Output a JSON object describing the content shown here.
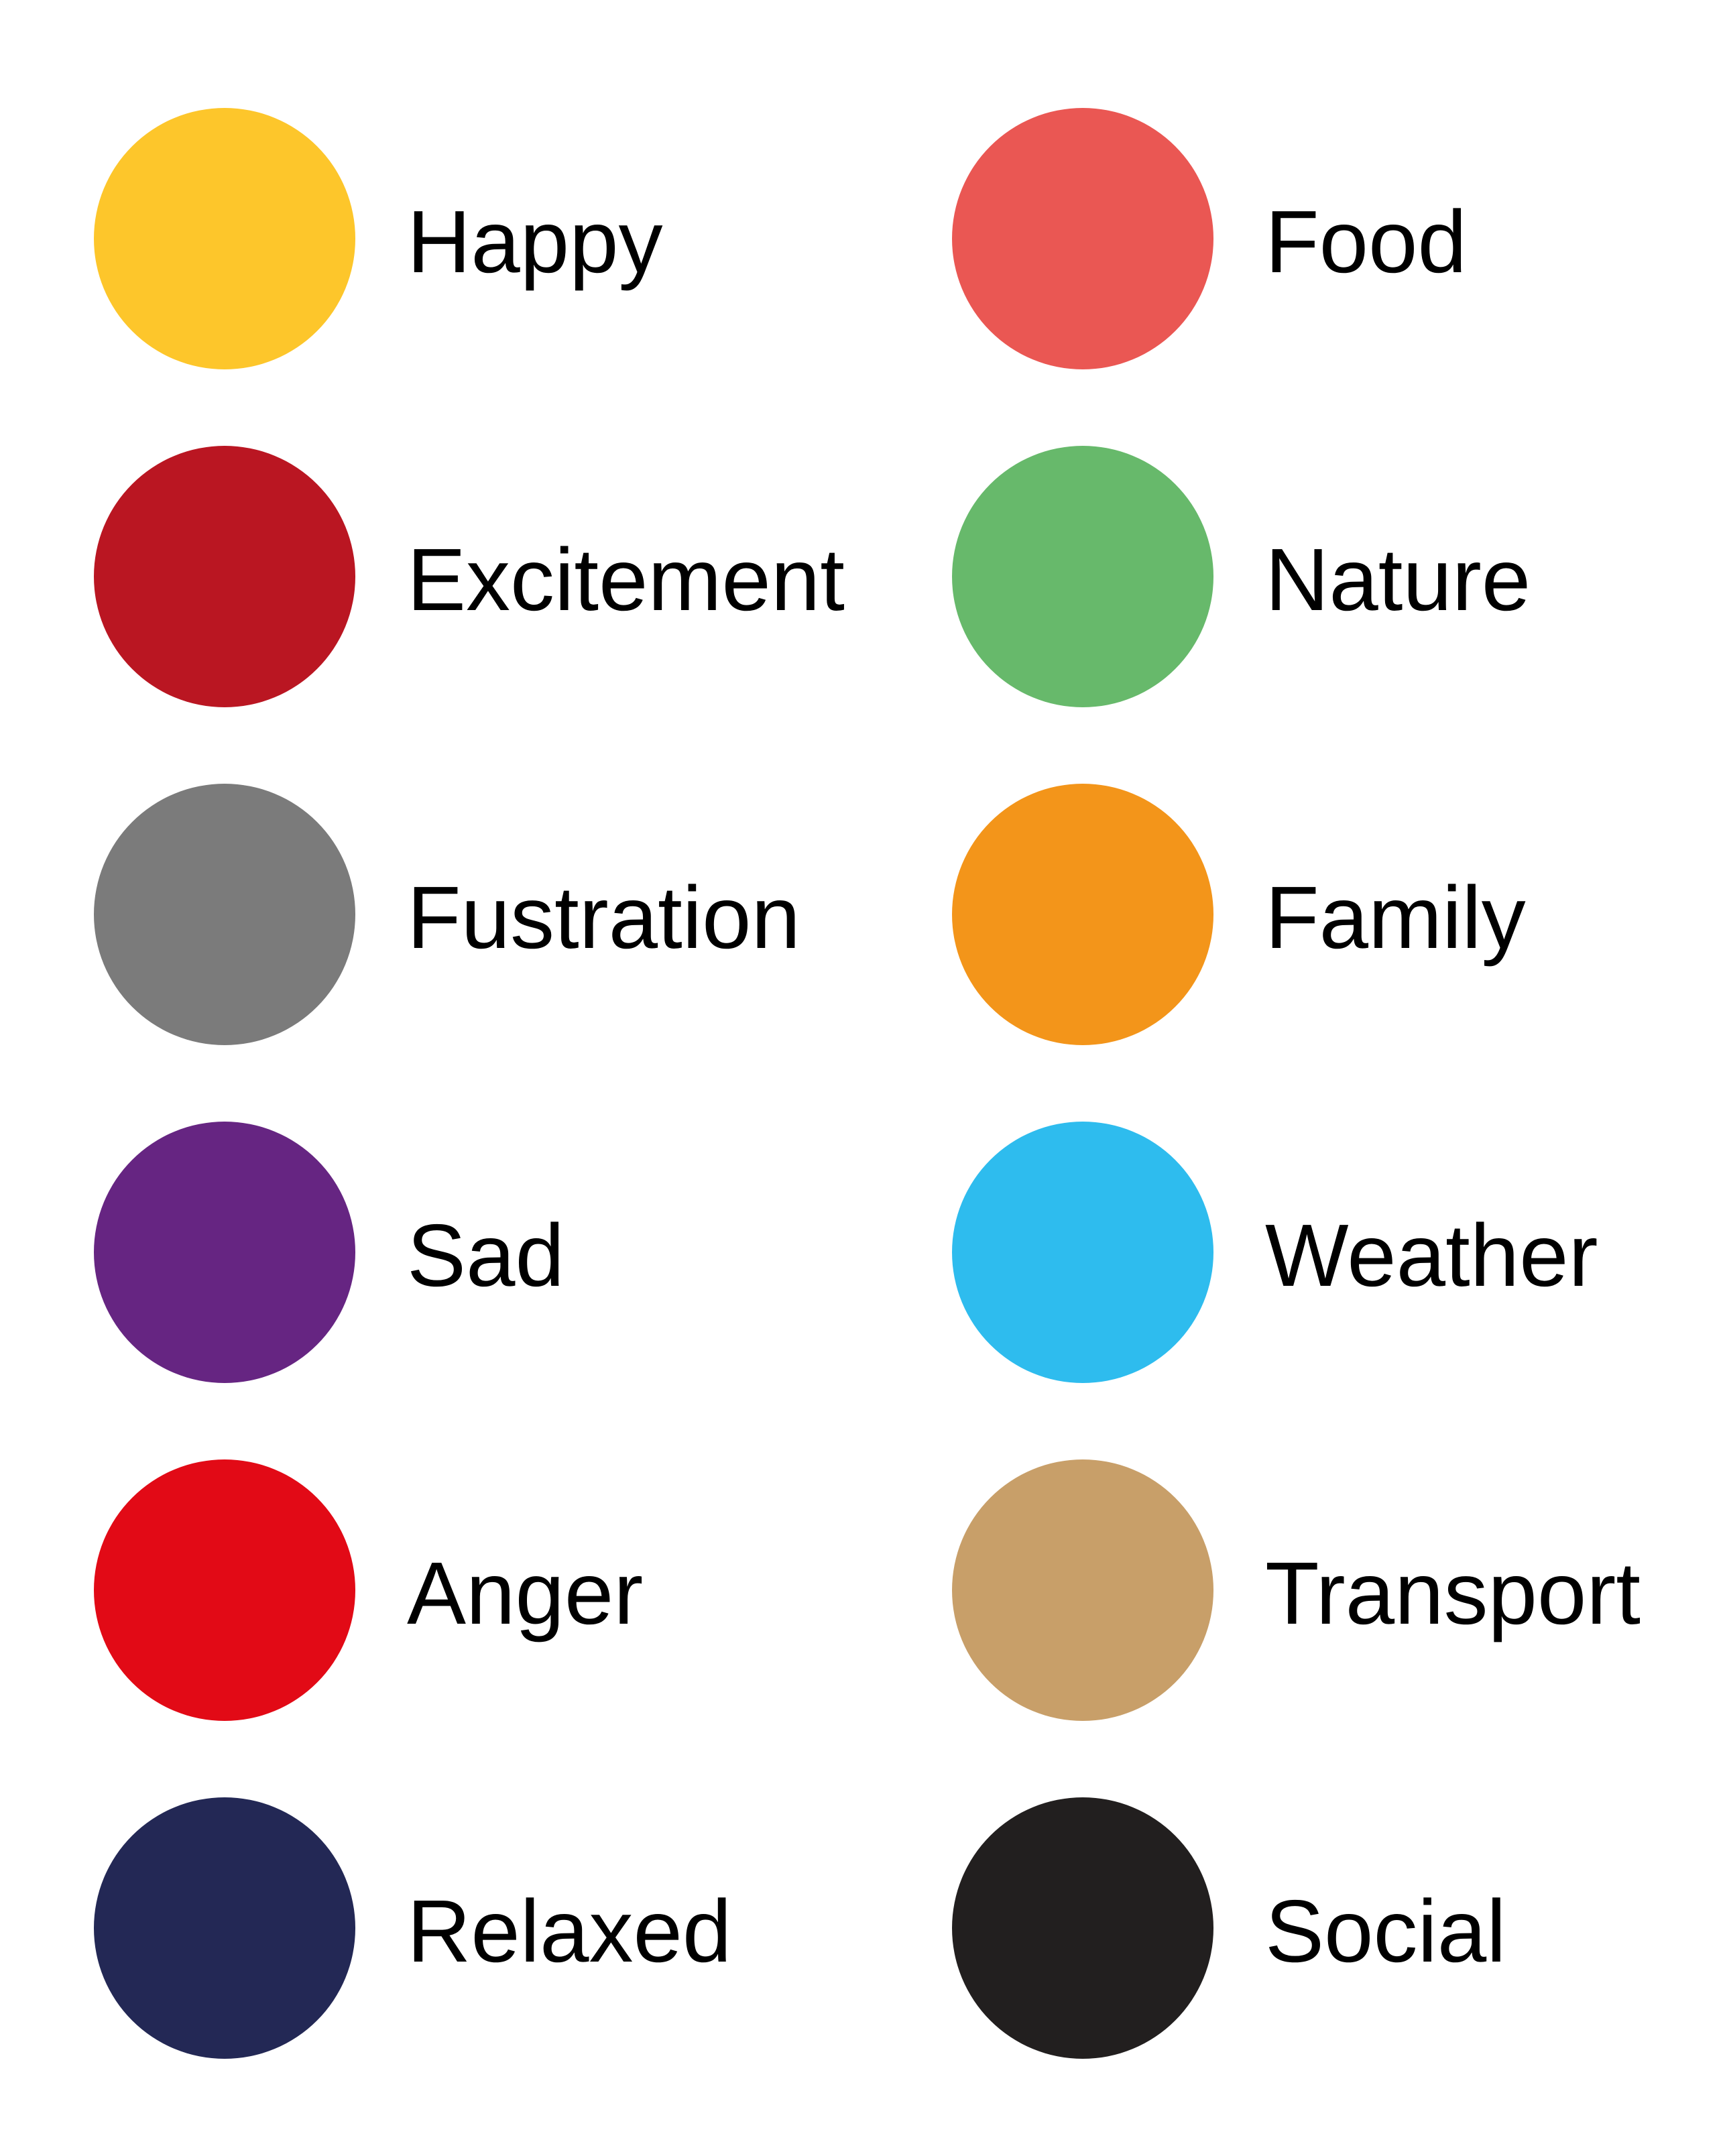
{
  "legend": {
    "left": [
      {
        "label": "Happy",
        "color": "#FDC62B"
      },
      {
        "label": "Excitement",
        "color": "#BA1622"
      },
      {
        "label": "Fustration",
        "color": "#7B7B7B"
      },
      {
        "label": "Sad",
        "color": "#662582"
      },
      {
        "label": "Anger",
        "color": "#E20A16"
      },
      {
        "label": "Relaxed",
        "color": "#232855"
      }
    ],
    "right": [
      {
        "label": "Food",
        "color": "#EA5753"
      },
      {
        "label": "Nature",
        "color": "#67B96B"
      },
      {
        "label": "Family",
        "color": "#F3951A"
      },
      {
        "label": "Weather",
        "color": "#2EBCEE"
      },
      {
        "label": "Transport",
        "color": "#C89F69"
      },
      {
        "label": "Social",
        "color": "#221F1F"
      }
    ]
  }
}
